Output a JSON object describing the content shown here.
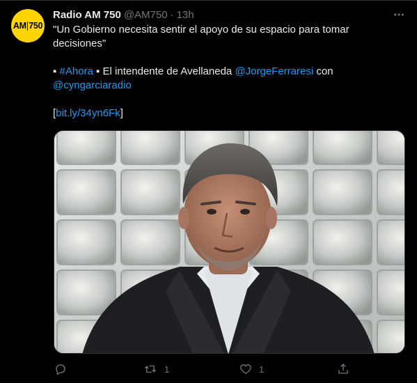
{
  "account": {
    "logo_text_left": "AM",
    "logo_text_right": "750",
    "name": "Radio AM 750",
    "handle": "@AM750",
    "separator": "·",
    "time": "13h"
  },
  "tweet": {
    "line1": "\"Un Gobierno necesita sentir el apoyo de su espacio para tomar decisiones\"",
    "bullet": "▪",
    "hashtag": "#Ahora",
    "line2_text": "El intendente de Avellaneda",
    "mention1": "@JorgeFerraresi",
    "line2_con": "con",
    "mention2": "@cyngarciaradio",
    "link_open": "[",
    "link": "bit.ly/34yn6Fk",
    "link_close": "]"
  },
  "actions": {
    "reply_count": "",
    "retweet_count": "1",
    "like_count": "1"
  },
  "icons": {
    "more": "more-dots-icon",
    "reply": "reply-icon",
    "retweet": "retweet-icon",
    "like": "heart-icon",
    "share": "share-icon"
  },
  "colors": {
    "background": "#000000",
    "text": "#e7e9ea",
    "muted": "#71767b",
    "link": "#1d9bf0",
    "avatar": "#ffd400"
  }
}
